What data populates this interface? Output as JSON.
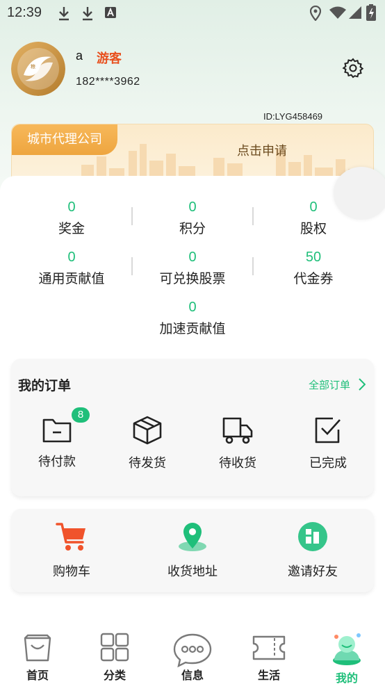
{
  "status_bar": {
    "time": "12:39"
  },
  "profile": {
    "username": "a",
    "role": "游客",
    "phone": "182****3962",
    "user_id": "ID:LYG458469"
  },
  "agency": {
    "tag": "城市代理公司",
    "apply": "点击申请"
  },
  "stats": [
    {
      "value": "0",
      "label": "奖金"
    },
    {
      "value": "0",
      "label": "积分"
    },
    {
      "value": "0",
      "label": "股权"
    },
    {
      "value": "0",
      "label": "通用贡献值"
    },
    {
      "value": "0",
      "label": "可兑换股票"
    },
    {
      "value": "50",
      "label": "代金券"
    },
    {
      "value": "0",
      "label": "加速贡献值"
    }
  ],
  "orders": {
    "title": "我的订单",
    "all": "全部订单",
    "items": [
      {
        "label": "待付款",
        "badge": "8"
      },
      {
        "label": "待发货"
      },
      {
        "label": "待收货"
      },
      {
        "label": "已完成"
      }
    ]
  },
  "services": [
    {
      "label": "购物车"
    },
    {
      "label": "收货地址"
    },
    {
      "label": "邀请好友"
    }
  ],
  "nav": [
    {
      "label": "首页"
    },
    {
      "label": "分类"
    },
    {
      "label": "信息"
    },
    {
      "label": "生活"
    },
    {
      "label": "我的"
    }
  ],
  "colors": {
    "accent": "#1fbf7a",
    "guest": "#e8501e",
    "agency": "#f0a944"
  }
}
